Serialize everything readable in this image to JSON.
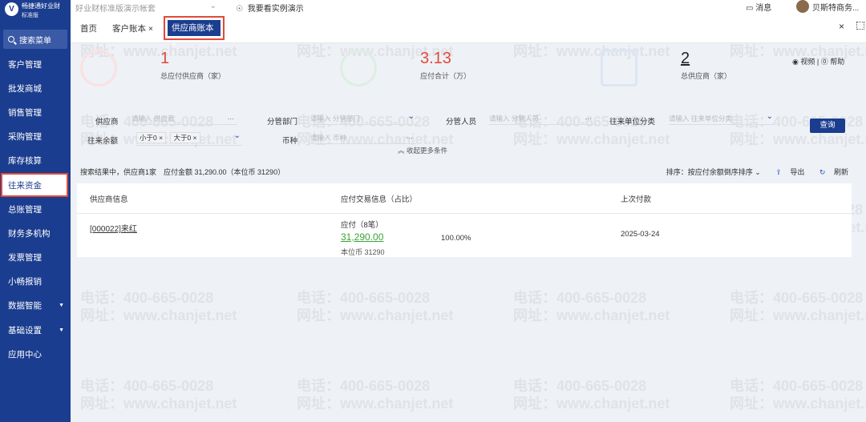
{
  "app": {
    "logo_text": "畅捷通好业财",
    "edition": "标准版",
    "logo_glyph": "V"
  },
  "sidebar": {
    "search_label": "搜索菜单",
    "items": [
      {
        "label": "客户管理"
      },
      {
        "label": "批发商城"
      },
      {
        "label": "销售管理"
      },
      {
        "label": "采购管理"
      },
      {
        "label": "库存核算"
      },
      {
        "label": "往来资金",
        "active": true
      },
      {
        "label": "总账管理"
      },
      {
        "label": "财务多机构"
      },
      {
        "label": "发票管理"
      },
      {
        "label": "小畅报销"
      },
      {
        "label": "数据智能",
        "has_caret": true
      },
      {
        "label": "基础设置",
        "has_caret": true
      },
      {
        "label": "应用中心"
      }
    ]
  },
  "topbar": {
    "company": "好业财标准版演示帐套",
    "demo_link": "我要看实例演示",
    "messages": "消息",
    "user": "贝斯特商务..."
  },
  "tabs": {
    "home": "首页",
    "customer": "客户账本",
    "supplier": "供应商账本",
    "close_glyph": "×"
  },
  "stats": {
    "supplier_count": {
      "value": "1",
      "label": "总应付供应商（家）"
    },
    "payable_total": {
      "value": "3.13",
      "label": "应付合计（万）"
    },
    "total_suppliers": {
      "value": "2",
      "label": "总供应商（家）"
    },
    "video_label": "视频",
    "help_label": "帮助"
  },
  "filters": {
    "supplier": {
      "label": "供应商",
      "placeholder": "请输入 供应商"
    },
    "department": {
      "label": "分管部门",
      "placeholder": "请输入 分管部门"
    },
    "staff": {
      "label": "分管人员",
      "placeholder": "请输入 分管人员"
    },
    "category": {
      "label": "往来单位分类",
      "placeholder": "请输入 往来单位分类"
    },
    "balance": {
      "label": "往来余额",
      "chips": [
        "小于0",
        "大于0"
      ]
    },
    "currency": {
      "label": "币种",
      "placeholder": "请输入 币种"
    },
    "query_button": "查询",
    "collapse_label": "收起更多条件"
  },
  "results": {
    "summary": "搜索结果中，供应商1家　应付金额 31,290.00（本位币 31290）",
    "sort_label": "排序：按应付余额倒序排序",
    "export_label": "导出",
    "refresh_label": "刷新"
  },
  "table": {
    "headers": [
      "供应商信息",
      "应付交易信息（占比）",
      "上次付款"
    ],
    "rows": [
      {
        "supplier": "[000022]来红",
        "pay_type": "应付（8笔）",
        "amount": "31,290.00",
        "base_amount": "本位币 31290",
        "percent": "100.00%",
        "last_payment": "2025-03-24"
      }
    ]
  },
  "watermark": {
    "phone": "电话：400-665-0028",
    "site": "网址：www.chanjet.net"
  },
  "colors": {
    "sidebar": "#1b3d8f",
    "accent_red": "#e04a3a",
    "amount_green": "#3aa535"
  }
}
